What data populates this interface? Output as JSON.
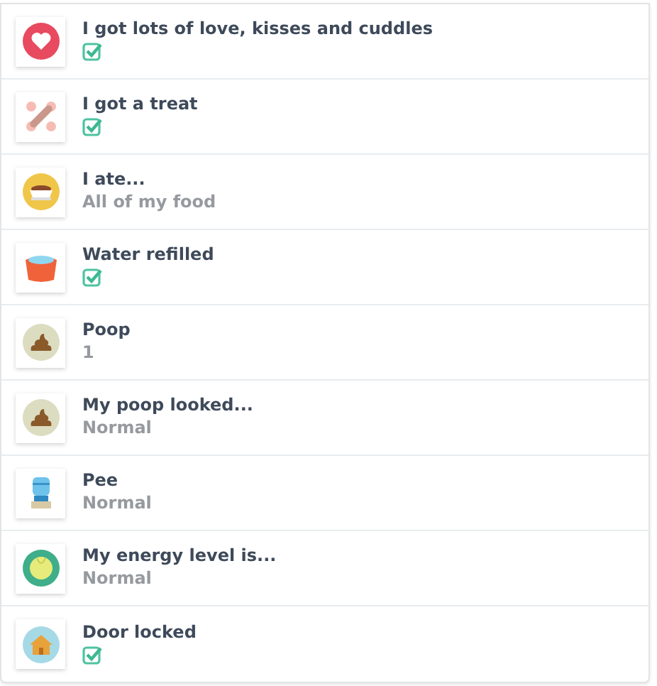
{
  "entries": [
    {
      "title": "I got lots of love, kisses and cuddles",
      "kind": "check",
      "checked": true
    },
    {
      "title": "I got a treat",
      "kind": "check",
      "checked": true
    },
    {
      "title": "I ate...",
      "kind": "value",
      "value": "All of my food"
    },
    {
      "title": "Water refilled",
      "kind": "check",
      "checked": true
    },
    {
      "title": "Poop",
      "kind": "value",
      "value": "1"
    },
    {
      "title": "My poop looked...",
      "kind": "value",
      "value": "Normal"
    },
    {
      "title": "Pee",
      "kind": "value",
      "value": "Normal"
    },
    {
      "title": "My energy level is...",
      "kind": "value",
      "value": "Normal"
    },
    {
      "title": "Door locked",
      "kind": "check",
      "checked": true
    }
  ]
}
